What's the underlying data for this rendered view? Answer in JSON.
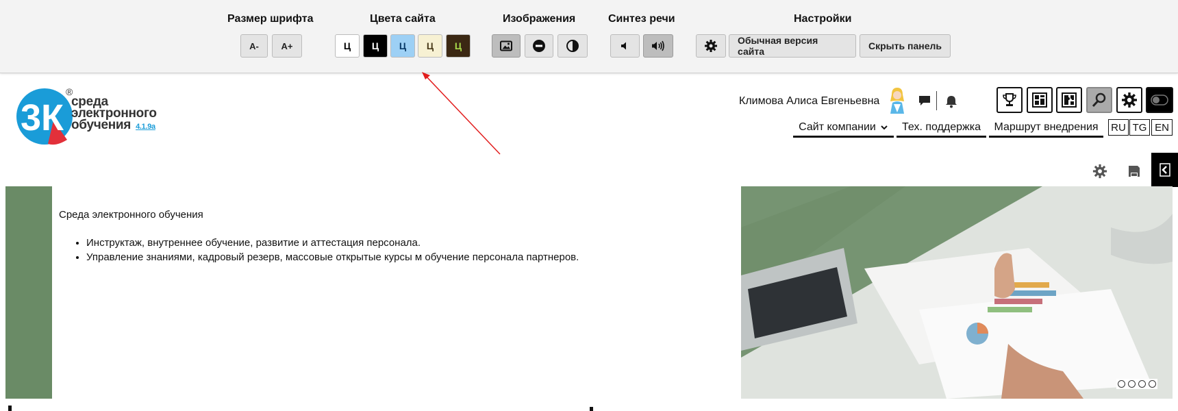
{
  "a11y": {
    "font_title": "Размер шрифта",
    "font_minus": "A-",
    "font_plus": "A+",
    "colors_title": "Цвета сайта",
    "color_swatches": [
      {
        "label": "Ц",
        "bg": "#ffffff",
        "fg": "#000000"
      },
      {
        "label": "Ц",
        "bg": "#000000",
        "fg": "#ffffff"
      },
      {
        "label": "Ц",
        "bg": "#9dd0f5",
        "fg": "#0a3b69"
      },
      {
        "label": "Ц",
        "bg": "#f7f1d3",
        "fg": "#4a3b1a"
      },
      {
        "label": "Ц",
        "bg": "#3b2813",
        "fg": "#a6d84a"
      }
    ],
    "images_title": "Изображения",
    "speech_title": "Синтез речи",
    "settings_title": "Настройки",
    "normal_version": "Обычная версия сайта",
    "hide_panel": "Скрыть панель"
  },
  "header": {
    "logo_lines": [
      "среда",
      "электронного",
      "обучения"
    ],
    "logo_version": "4.1.9a",
    "logo_mark": "3К",
    "logo_reg": "®",
    "user_name": "Климова Алиса Евгеньевна",
    "nav": [
      "Сайт компании",
      "Тех. поддержка",
      "Маршрут внедрения"
    ],
    "langs": [
      "RU",
      "TG",
      "EN"
    ]
  },
  "content": {
    "intro": "Среда электронного обучения",
    "bullets": [
      "Инструктаж, внутреннее обучение, развитие и аттестация персонала.",
      "Управление знаниями, кадровый резерв, массовые открытые курсы м обучение персонала партнеров."
    ],
    "slides_count": 4
  },
  "colors": {
    "green_accent": "#6a8b66",
    "logo_blue": "#1a9cd8",
    "logo_red": "#e2303a",
    "annotation_red": "#e21d1d"
  }
}
